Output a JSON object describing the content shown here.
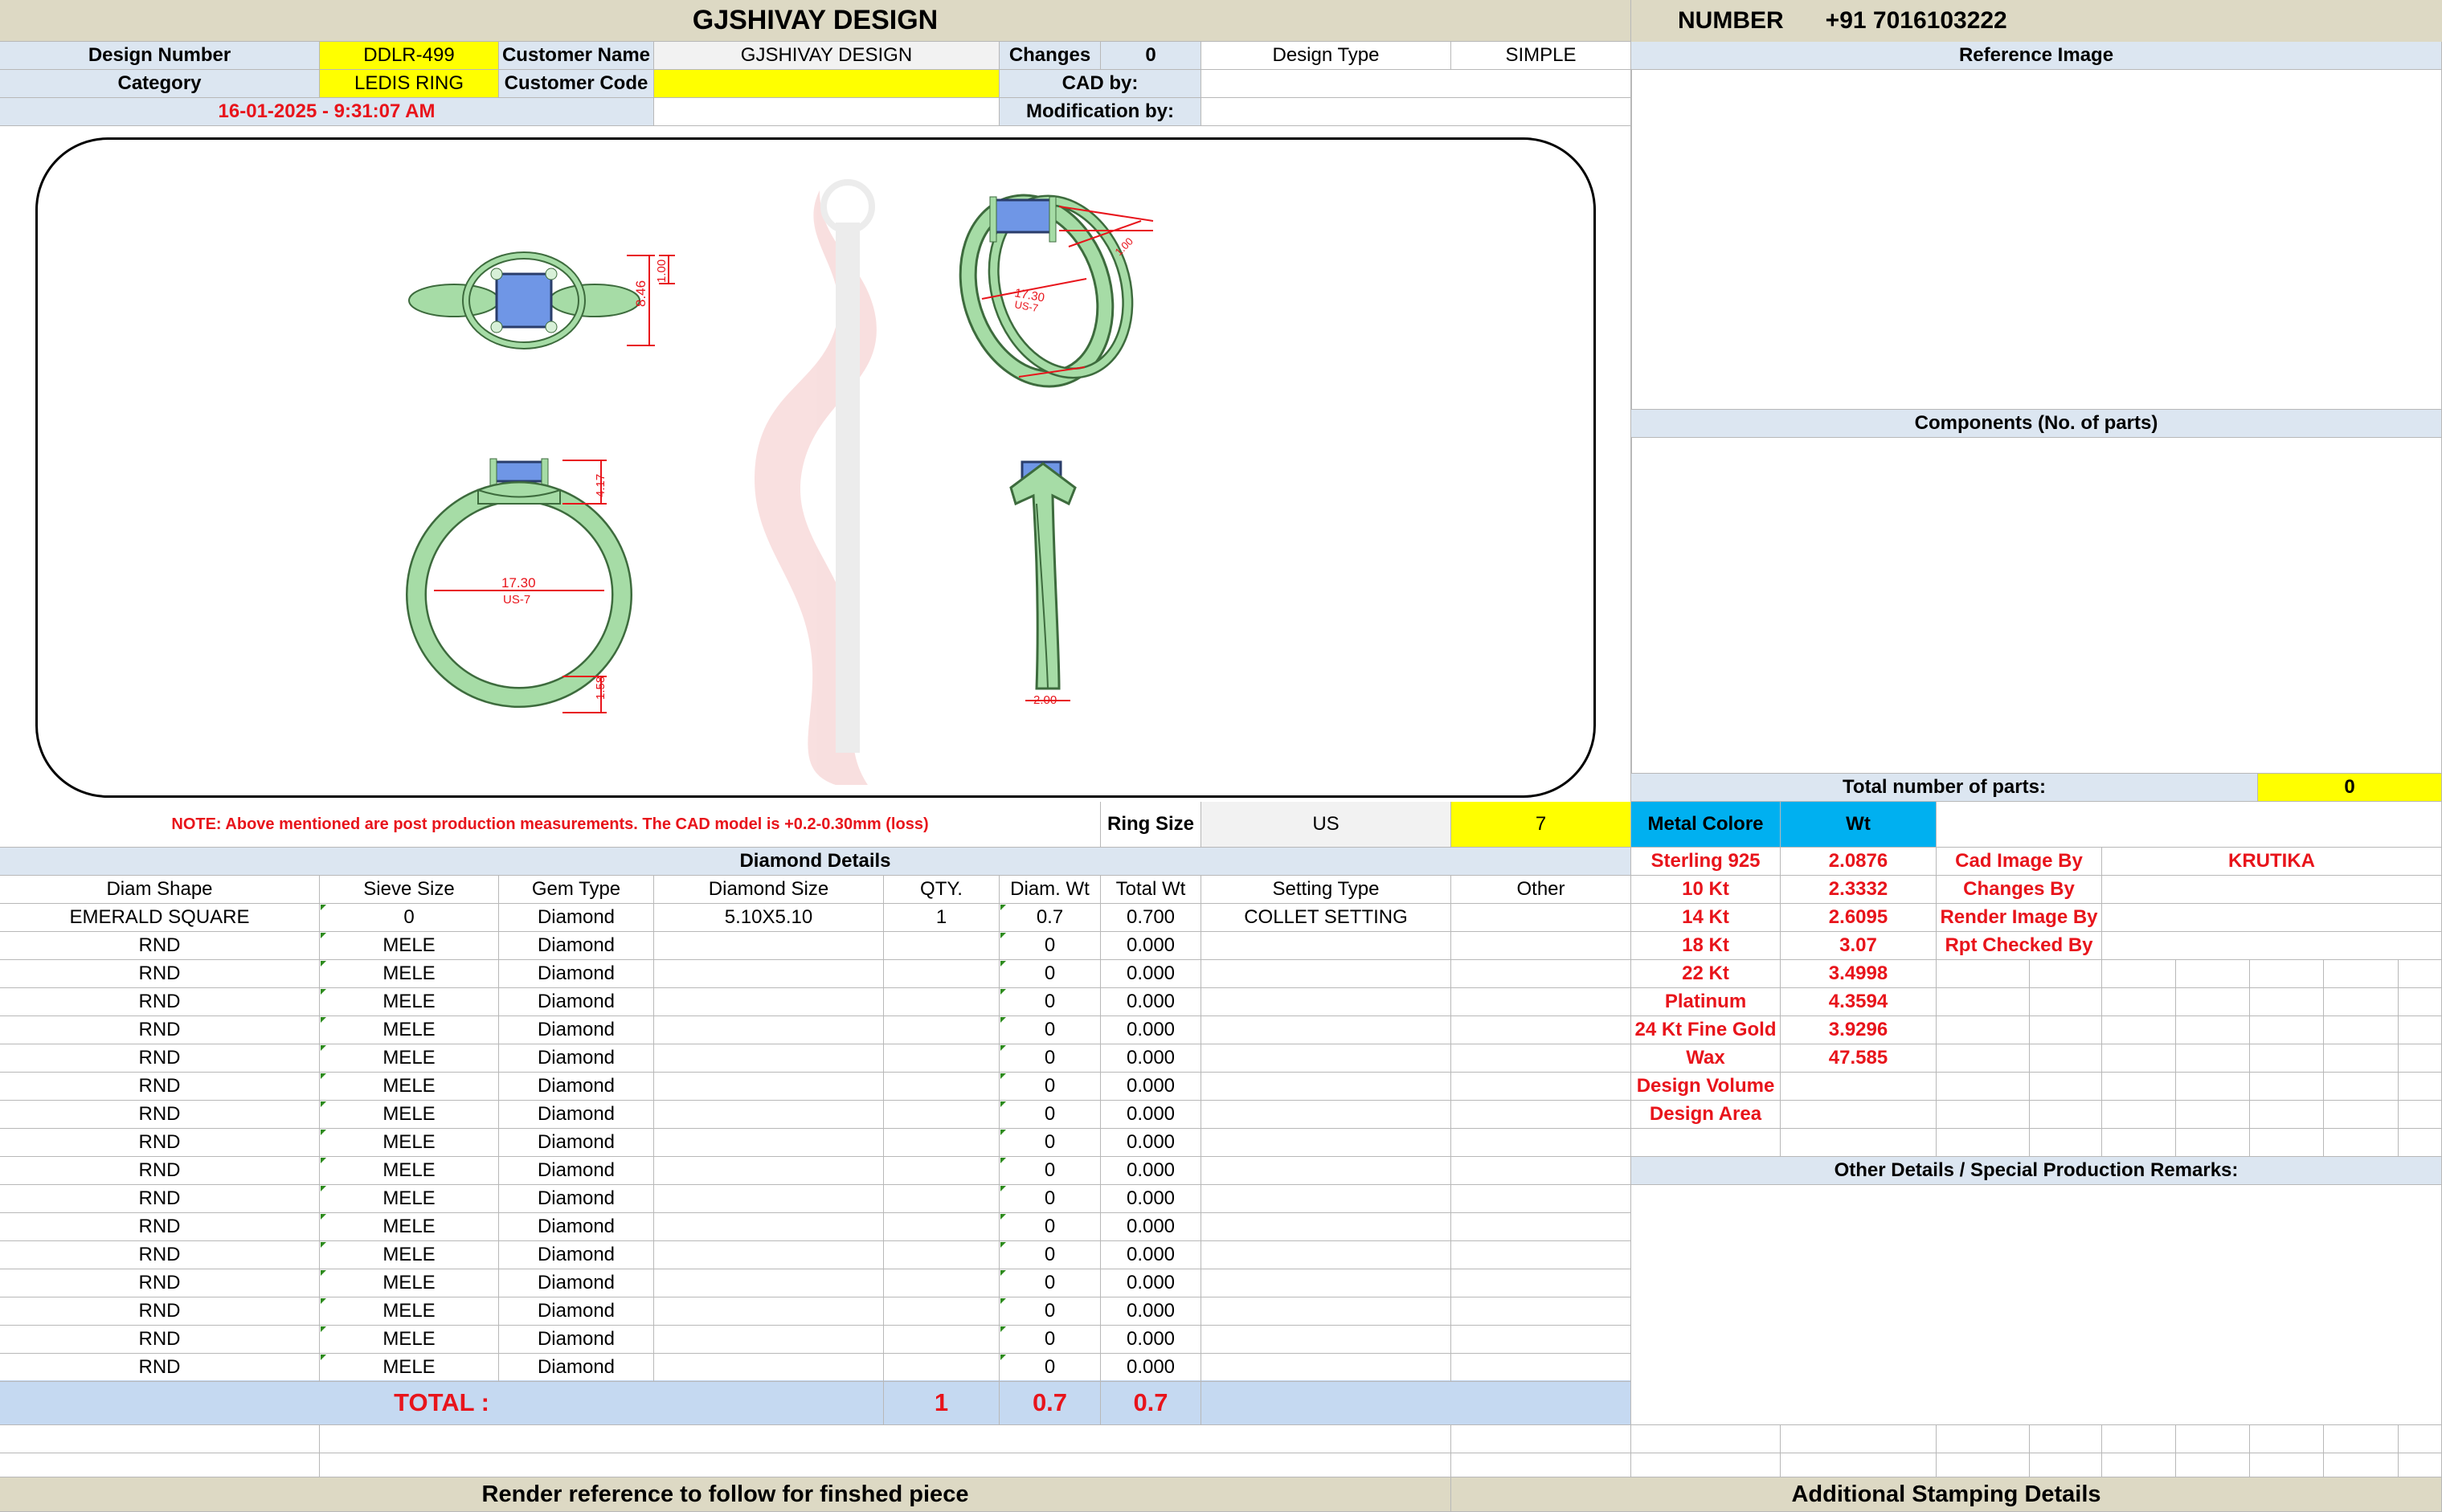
{
  "title": "GJSHIVAY DESIGN",
  "number_label": "NUMBER",
  "phone": "+91 7016103222",
  "design_number_label": "Design Number",
  "design_number": "DDLR-499",
  "customer_name_label": "Customer Name",
  "customer_name": "GJSHIVAY DESIGN",
  "changes_label": "Changes",
  "changes": "0",
  "design_type_label": "Design Type",
  "design_type": "SIMPLE",
  "category_label": "Category",
  "category": "LEDIS RING",
  "customer_code_label": "Customer Code",
  "customer_code": "",
  "cad_by_label": "CAD by:",
  "cad_by": "",
  "datetime": "16-01-2025 - 9:31:07 AM",
  "modification_by_label": "Modification by:",
  "reference_image_label": "Reference Image",
  "components_label": "Components (No. of parts)",
  "total_parts_label": "Total number of parts:",
  "total_parts": "0",
  "note": "NOTE: Above mentioned are post production measurements. The CAD model is +0.2-0.30mm (loss)",
  "ring_size_label": "Ring Size",
  "ring_size_system": "US",
  "ring_size": "7",
  "metal_colore_label": "Metal Colore",
  "wt_label": "Wt",
  "diamond_details_label": "Diamond Details",
  "diamond_columns": [
    "Diam Shape",
    "Sieve Size",
    "Gem Type",
    "Diamond Size",
    "QTY.",
    "Diam. Wt",
    "Total Wt",
    "Setting Type",
    "Other"
  ],
  "diamond_rows": [
    [
      "EMERALD SQUARE",
      "0",
      "Diamond",
      "5.10X5.10",
      "1",
      "0.7",
      "0.700",
      "COLLET SETTING",
      ""
    ],
    [
      "RND",
      "MELE",
      "Diamond",
      "",
      "",
      "0",
      "0.000",
      "",
      ""
    ],
    [
      "RND",
      "MELE",
      "Diamond",
      "",
      "",
      "0",
      "0.000",
      "",
      ""
    ],
    [
      "RND",
      "MELE",
      "Diamond",
      "",
      "",
      "0",
      "0.000",
      "",
      ""
    ],
    [
      "RND",
      "MELE",
      "Diamond",
      "",
      "",
      "0",
      "0.000",
      "",
      ""
    ],
    [
      "RND",
      "MELE",
      "Diamond",
      "",
      "",
      "0",
      "0.000",
      "",
      ""
    ],
    [
      "RND",
      "MELE",
      "Diamond",
      "",
      "",
      "0",
      "0.000",
      "",
      ""
    ],
    [
      "RND",
      "MELE",
      "Diamond",
      "",
      "",
      "0",
      "0.000",
      "",
      ""
    ],
    [
      "RND",
      "MELE",
      "Diamond",
      "",
      "",
      "0",
      "0.000",
      "",
      ""
    ],
    [
      "RND",
      "MELE",
      "Diamond",
      "",
      "",
      "0",
      "0.000",
      "",
      ""
    ],
    [
      "RND",
      "MELE",
      "Diamond",
      "",
      "",
      "0",
      "0.000",
      "",
      ""
    ],
    [
      "RND",
      "MELE",
      "Diamond",
      "",
      "",
      "0",
      "0.000",
      "",
      ""
    ],
    [
      "RND",
      "MELE",
      "Diamond",
      "",
      "",
      "0",
      "0.000",
      "",
      ""
    ],
    [
      "RND",
      "MELE",
      "Diamond",
      "",
      "",
      "0",
      "0.000",
      "",
      ""
    ],
    [
      "RND",
      "MELE",
      "Diamond",
      "",
      "",
      "0",
      "0.000",
      "",
      ""
    ],
    [
      "RND",
      "MELE",
      "Diamond",
      "",
      "",
      "0",
      "0.000",
      "",
      ""
    ],
    [
      "RND",
      "MELE",
      "Diamond",
      "",
      "",
      "0",
      "0.000",
      "",
      ""
    ]
  ],
  "total_label": "TOTAL :",
  "total_qty": "1",
  "total_diam_wt": "0.7",
  "total_wt": "0.7",
  "metal_rows": [
    [
      "Sterling 925",
      "2.0876"
    ],
    [
      "10 Kt",
      "2.3332"
    ],
    [
      "14 Kt",
      "2.6095"
    ],
    [
      "18 Kt",
      "3.07"
    ],
    [
      "22 Kt",
      "3.4998"
    ],
    [
      "Platinum",
      "4.3594"
    ],
    [
      "24 Kt Fine Gold",
      "3.9296"
    ],
    [
      "Wax",
      "47.585"
    ],
    [
      "Design Volume",
      ""
    ],
    [
      "Design Area",
      ""
    ]
  ],
  "cad_image_by_label": "Cad Image By",
  "cad_image_by": "KRUTIKA",
  "changes_by_label": "Changes By",
  "render_image_by_label": "Render Image By",
  "rpt_checked_by_label": "Rpt Checked By",
  "other_details_label": "Other Details / Special Production Remarks:",
  "render_reference_label": "Render reference to follow for finshed piece",
  "additional_stamping_label": "Additional Stamping Details",
  "dims": {
    "top_height": "1.00",
    "top_width": "8.46",
    "front_inner": "17.30",
    "front_size": "US-7",
    "front_head": "4.17",
    "front_shank": "1.58",
    "side_width": "2.00",
    "persp_inner": "17.30",
    "persp_size": "US-7"
  },
  "colors": {
    "ring_green": "#a6dca6",
    "stone_blue": "#6f96e6",
    "dim_red": "#e8141b",
    "header_beige": "#ddd9c4",
    "highlight_yellow": "#ffff00",
    "label_blue": "#dce6f1",
    "total_blue": "#c5d9f1",
    "cyan": "#00b0f0"
  }
}
